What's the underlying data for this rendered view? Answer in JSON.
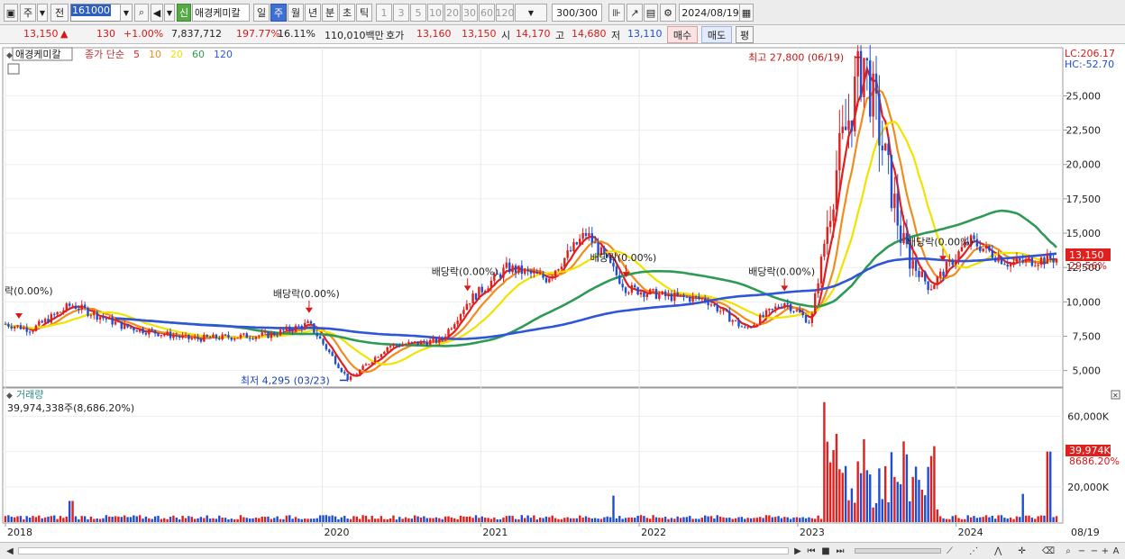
{
  "toolbar": {
    "period_label": "주",
    "prev_label": "전",
    "stock_code": "161000",
    "stock_badge": "신",
    "stock_name": "애경케미칼",
    "periods": [
      "일",
      "주",
      "월",
      "년",
      "분",
      "초",
      "틱"
    ],
    "intervals": [
      "1",
      "3",
      "5",
      "10",
      "20",
      "30",
      "60",
      "120"
    ],
    "count_value": "300",
    "count_max": "/300",
    "date_value": "2024/08/19"
  },
  "quote": {
    "price": "13,150",
    "direction": "▲",
    "change": "130",
    "change_pct": "+1.00%",
    "volume": "7,837,712",
    "vol_ratio": "197.77%",
    "turnover": "16.11%",
    "amount": "110,010백만",
    "ask_label": "호가",
    "ask1": "13,160",
    "ask2": "13,150",
    "open_label": "시",
    "open": "14,170",
    "high_label": "고",
    "high": "14,680",
    "low_label": "저",
    "low": "13,110",
    "buy_label": "매수",
    "sell_label": "매도",
    "eval_label": "평"
  },
  "price_panel": {
    "stock_name": "애경케미칼",
    "legend_prefix": "종가 단순",
    "ma_periods": [
      "5",
      "10",
      "20",
      "60",
      "120"
    ],
    "ma_colors": [
      "#e0201e",
      "#f08c1e",
      "#f2e200",
      "#2f9a55",
      "#2f55d8"
    ],
    "lc_label": "LC:206.17",
    "hc_label": "HC:-52.70",
    "current_price_tag": "13,150",
    "current_pct_tag": "29.56%",
    "yticks": [
      "25,000",
      "22,500",
      "20,000",
      "17,500",
      "15,000",
      "12,500",
      "10,000",
      "7,500",
      "5,000"
    ],
    "high_annotation": "최고 27,800 (06/19)",
    "low_annotation": "최저 4,295 (03/23)",
    "dividend_label": "배당락(0.00%)",
    "dividend_edge_label": "락(0.00%)",
    "up_color": "#e0201e",
    "down_color": "#1f4fd0"
  },
  "volume_panel": {
    "title": "거래량",
    "value": "39,974,338주(8,686.20%)",
    "yticks": [
      "60,000K",
      "40,000K",
      "20,000K"
    ],
    "current_tag": "39,974K",
    "current_pct": "8686.20%"
  },
  "xaxis": {
    "labels": [
      "2018",
      "2020",
      "2021",
      "2022",
      "2023",
      "2024"
    ],
    "end_label": "08/19"
  },
  "chart_data": {
    "type": "candlestick",
    "interval": "weekly",
    "x_range": [
      "2018",
      "2024/08/19"
    ],
    "y_range": [
      3800,
      28500
    ],
    "moving_averages": [
      "5",
      "10",
      "20",
      "60",
      "120"
    ],
    "price_path": [
      {
        "x": "2018-01",
        "y": 8400
      },
      {
        "x": "2018-03",
        "y": 8000
      },
      {
        "x": "2018-06",
        "y": 9800
      },
      {
        "x": "2018-10",
        "y": 8200
      },
      {
        "x": "2019-03",
        "y": 7300
      },
      {
        "x": "2019-09",
        "y": 7600
      },
      {
        "x": "2019-12",
        "y": 8400
      },
      {
        "x": "2020-03",
        "y": 4300
      },
      {
        "x": "2020-06",
        "y": 6800
      },
      {
        "x": "2020-10",
        "y": 7200
      },
      {
        "x": "2020-12",
        "y": 10000
      },
      {
        "x": "2021-03",
        "y": 12500
      },
      {
        "x": "2021-06",
        "y": 11700
      },
      {
        "x": "2021-09",
        "y": 15000
      },
      {
        "x": "2021-12",
        "y": 11000
      },
      {
        "x": "2022-03",
        "y": 10400
      },
      {
        "x": "2022-06",
        "y": 10200
      },
      {
        "x": "2022-09",
        "y": 8000
      },
      {
        "x": "2022-12",
        "y": 10000
      },
      {
        "x": "2023-02",
        "y": 8500
      },
      {
        "x": "2023-04",
        "y": 20000
      },
      {
        "x": "2023-06",
        "y": 27800
      },
      {
        "x": "2023-09",
        "y": 14000
      },
      {
        "x": "2023-11",
        "y": 11000
      },
      {
        "x": "2024-02",
        "y": 14500
      },
      {
        "x": "2024-05",
        "y": 12800
      },
      {
        "x": "2024-08",
        "y": 13150
      }
    ],
    "annotations": [
      {
        "text": "최고 27,800 (06/19)",
        "x": "2023-06",
        "y": 27800
      },
      {
        "text": "최저 4,295 (03/23)",
        "x": "2020-03",
        "y": 4295
      },
      {
        "text": "배당락(0.00%)",
        "x": "2019-12"
      },
      {
        "text": "배당락(0.00%)",
        "x": "2020-12"
      },
      {
        "text": "배당락(0.00%)",
        "x": "2021-12"
      },
      {
        "text": "배당락(0.00%)",
        "x": "2022-12"
      },
      {
        "text": "배당락(0.00%)",
        "x": "2023-12"
      }
    ],
    "volume_spikes": [
      {
        "x": "2018-06",
        "value": 12000
      },
      {
        "x": "2021-11",
        "value": 15000
      },
      {
        "x": "2023-03",
        "value": 68000
      },
      {
        "x": "2023-04",
        "value": 50000
      },
      {
        "x": "2023-06",
        "value": 47000
      },
      {
        "x": "2024-06",
        "value": 16000
      },
      {
        "x": "2024-08",
        "value": 39974
      }
    ]
  }
}
